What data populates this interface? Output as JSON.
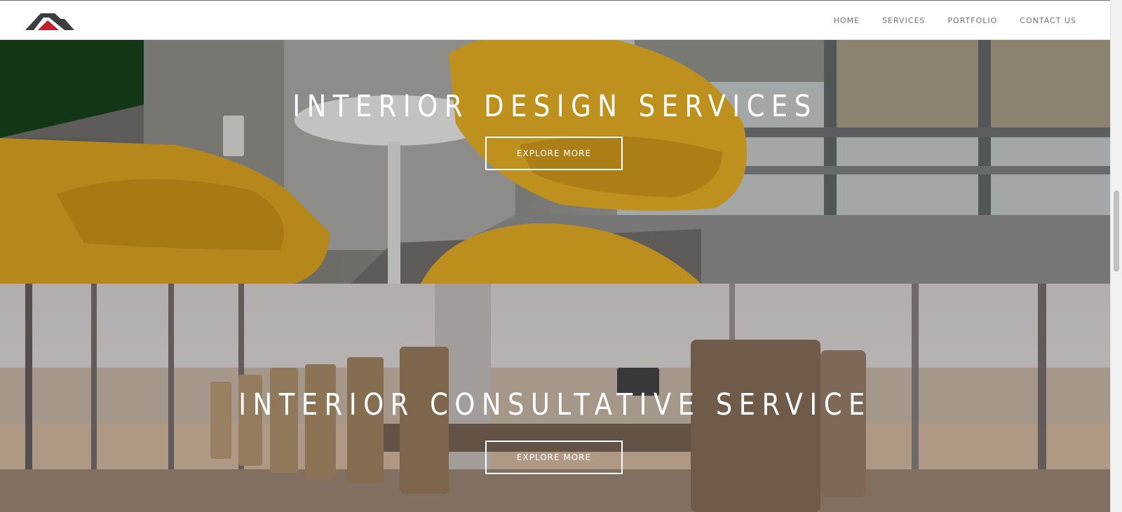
{
  "brand": {
    "logo_icon": "roof-logo-icon",
    "colors": {
      "dark": "#3d3d3f",
      "red": "#c0202a"
    }
  },
  "nav": {
    "items": [
      {
        "label": "HOME"
      },
      {
        "label": "SERVICES"
      },
      {
        "label": "PORTFOLIO"
      },
      {
        "label": "CONTACT US"
      }
    ]
  },
  "sections": [
    {
      "title": "INTERIOR DESIGN SERVICES",
      "button_label": "EXPLORE MORE"
    },
    {
      "title": "INTERIOR CONSULTATIVE SERVICE",
      "button_label": "EXPLORE MORE"
    }
  ],
  "colors": {
    "header_bg": "#ffffff",
    "nav_text": "#6f6f6f",
    "hero_text": "#ffffff",
    "chair_yellow": "#e3ad22"
  }
}
